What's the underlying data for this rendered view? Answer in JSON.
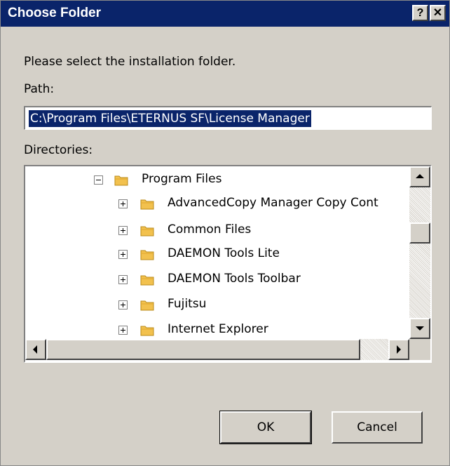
{
  "window": {
    "title": "Choose Folder",
    "help_label": "?",
    "close_label": "✕"
  },
  "instruction": "Please select the installation folder.",
  "path": {
    "label": "Path:",
    "value": "C:\\Program Files\\ETERNUS SF\\License Manager"
  },
  "directories": {
    "label": "Directories:",
    "root": {
      "label": "Program Files",
      "expanded": true
    },
    "children": [
      {
        "label": "AdvancedCopy Manager Copy Cont",
        "expanded": false
      },
      {
        "label": "Common Files",
        "expanded": false
      },
      {
        "label": "DAEMON Tools Lite",
        "expanded": false
      },
      {
        "label": "DAEMON Tools Toolbar",
        "expanded": false
      },
      {
        "label": "Fujitsu",
        "expanded": false
      },
      {
        "label": "Internet Explorer",
        "expanded": false
      }
    ]
  },
  "buttons": {
    "ok": "OK",
    "cancel": "Cancel"
  },
  "icons": {
    "folder": "folder-icon",
    "collapse": "minus-box-icon",
    "expand": "plus-box-icon"
  },
  "colors": {
    "titlebar": "#0a246a",
    "selection": "#0a246a",
    "dialog": "#d4d0c8",
    "folder": "#f2c14e"
  }
}
